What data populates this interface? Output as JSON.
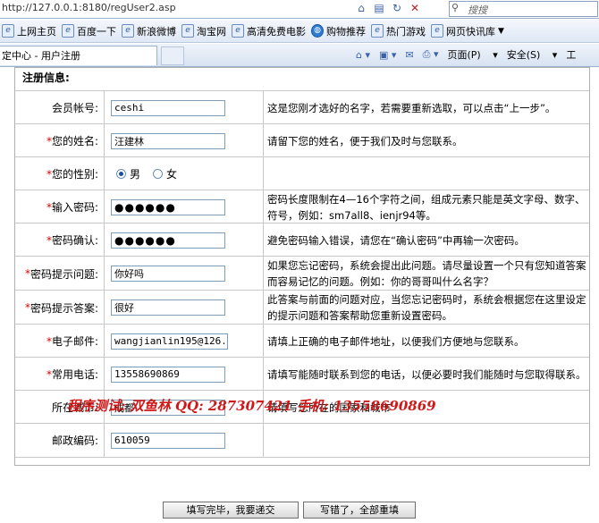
{
  "browser": {
    "url": "http://127.0.0.1:8180/regUser2.asp",
    "search_placeholder": "搜搜",
    "tab_title": "定中心 - 用户注册",
    "favorites": [
      {
        "label": "上网主页",
        "icon": "ie-page-icon"
      },
      {
        "label": "百度一下",
        "icon": "ie-page-icon"
      },
      {
        "label": "新浪微博",
        "icon": "ie-page-icon"
      },
      {
        "label": "淘宝网",
        "icon": "ie-page-icon"
      },
      {
        "label": "高清免费电影",
        "icon": "ie-page-icon"
      },
      {
        "label": "购物推荐",
        "icon": "globe-icon"
      },
      {
        "label": "热门游戏",
        "icon": "ie-page-icon"
      },
      {
        "label": "网页快讯库",
        "icon": "ie-page-icon",
        "dropdown": true
      }
    ],
    "commands": {
      "page": "页面(P)",
      "safety": "安全(S)",
      "tools": "工"
    }
  },
  "form": {
    "section_title": "注册信息:",
    "rows": [
      {
        "key": "account",
        "label": "会员帐号:",
        "required": false,
        "value": "ceshi",
        "hint": "这是您刚才选好的名字，若需要重新选取，可以点击“上一步”。"
      },
      {
        "key": "name",
        "label": "您的姓名:",
        "required": true,
        "value": "汪建林",
        "hint": "请留下您的姓名，便于我们及时与您联系。"
      },
      {
        "key": "gender",
        "label": "您的性别:",
        "required": true,
        "radio": [
          {
            "label": "男",
            "checked": true
          },
          {
            "label": "女",
            "checked": false
          }
        ],
        "hint": ""
      },
      {
        "key": "password",
        "label": "输入密码:",
        "required": true,
        "value": "●●●●●●",
        "hint": "密码长度限制在4—16个字符之间，组成元素只能是英文字母、数字、符号，例如：sm7all8、ienjr94等。"
      },
      {
        "key": "password_confirm",
        "label": "密码确认:",
        "required": true,
        "value": "●●●●●●",
        "hint": "避免密码输入错误，请您在“确认密码”中再输一次密码。"
      },
      {
        "key": "question",
        "label": "密码提示问题:",
        "required": true,
        "value": "你好吗",
        "hint": "如果您忘记密码，系统会提出此问题。请尽量设置一个只有您知道答案而容易记忆的问题。例如：你的哥哥叫什么名字？"
      },
      {
        "key": "answer",
        "label": "密码提示答案:",
        "required": true,
        "value": "很好",
        "hint": "此答案与前面的问题对应，当您忘记密码时，系统会根据您在这里设定的提示问题和答案帮助您重新设置密码。"
      },
      {
        "key": "email",
        "label": "电子邮件:",
        "required": true,
        "value": "wangjianlin195@126.co",
        "hint": "请填上正确的电子邮件地址，以便我们方便地与您联系。"
      },
      {
        "key": "phone",
        "label": "常用电话:",
        "required": true,
        "value": "13558690869",
        "hint": "请填写能随时联系到您的电话，以便必要时我们能随时与您取得联系。"
      },
      {
        "key": "city",
        "label": "所在城市:",
        "required": false,
        "value": "成都",
        "hint": "请填写您所在的国家和城市"
      },
      {
        "key": "zip",
        "label": "邮政编码:",
        "required": false,
        "value": "610059",
        "hint": ""
      }
    ],
    "credit": "程序测试: 双鱼林    QQ: 287307421    手机: 13558690869",
    "submit_label": "填写完毕，我要递交",
    "reset_label": "写错了，全部重填"
  }
}
